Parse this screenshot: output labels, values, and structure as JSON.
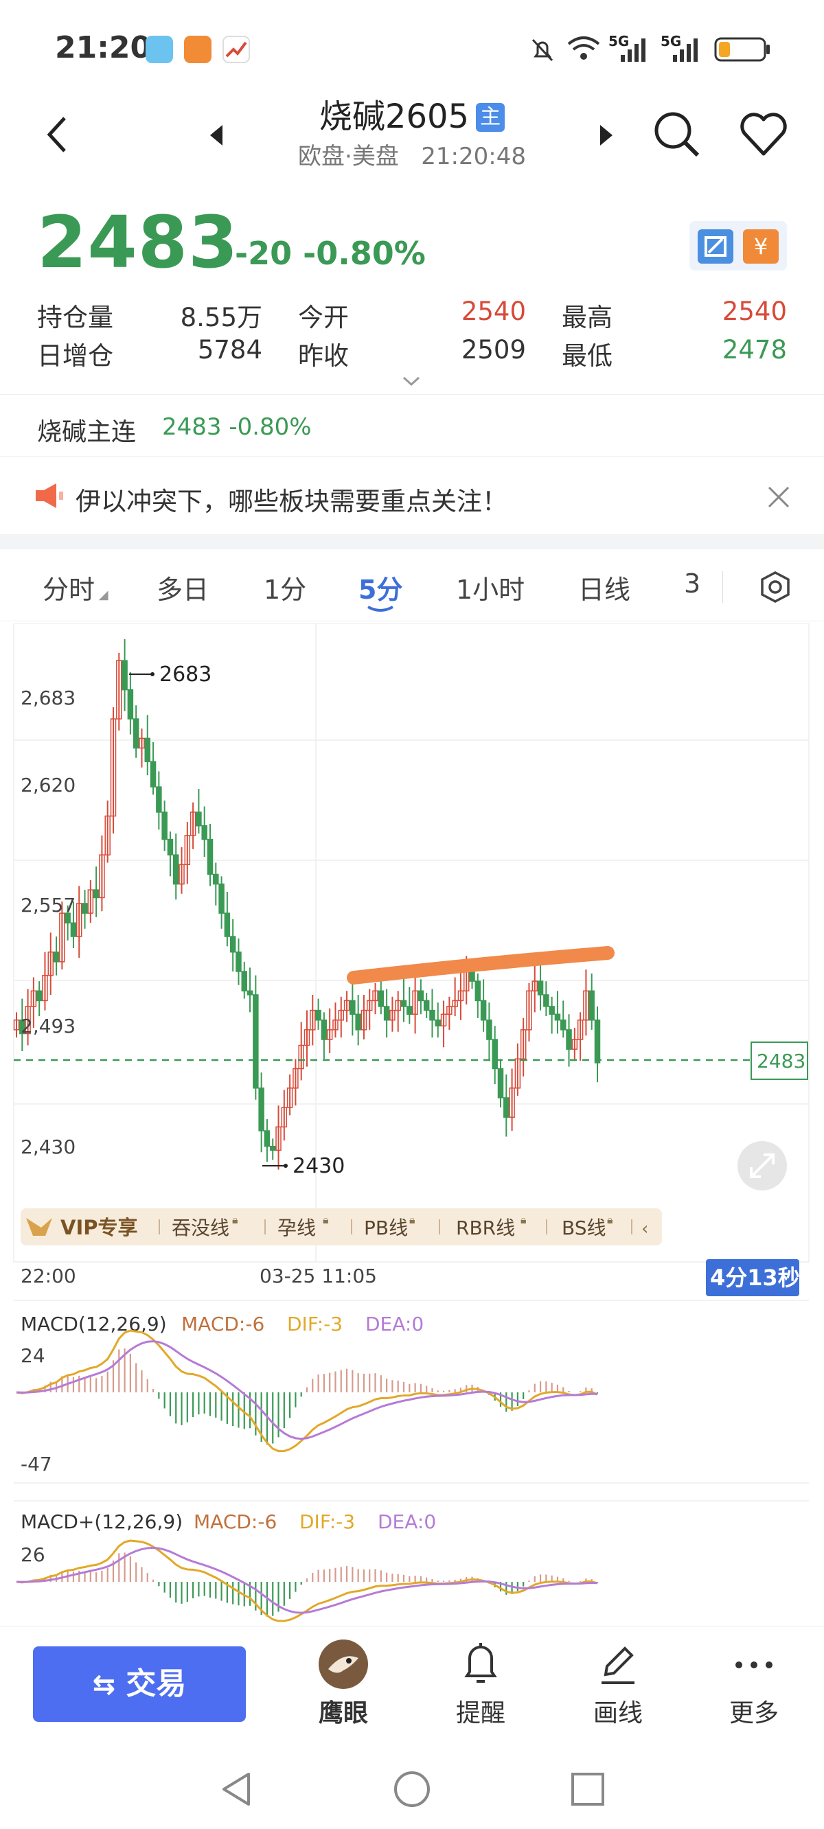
{
  "status": {
    "time": "21:20",
    "network1": "5G",
    "network2": "5G"
  },
  "header": {
    "title": "烧碱2605",
    "badge": "主",
    "market": "欧盘·美盘",
    "time": "21:20:48"
  },
  "quote": {
    "price": "2483",
    "change": "-20",
    "pct": "-0.80%",
    "stats": [
      {
        "label": "持仓量",
        "value": "8.55万",
        "label2": "今开",
        "value2": "2540",
        "label3": "最高",
        "value3": "2540"
      },
      {
        "label": "日增仓",
        "value": "5784",
        "label2": "昨收",
        "value2": "2509",
        "label3": "最低",
        "value3": "2478"
      }
    ]
  },
  "main_contract": {
    "name": "烧碱主连",
    "value": "2483 -0.80%"
  },
  "news": {
    "text": "伊以冲突下，哪些板块需要重点关注！"
  },
  "tabs": [
    "分时",
    "多日",
    "1分",
    "5分",
    "1小时",
    "日线",
    "3"
  ],
  "chart": {
    "y_ticks": [
      "2,683",
      "2,620",
      "2,557",
      "2,493",
      "2,430"
    ],
    "max_label": "2683",
    "min_label": "2430",
    "current": "2483",
    "x_labels": [
      "22:00",
      "03-25 11:05"
    ],
    "countdown": "4分13秒",
    "vip": {
      "title": "VIP专享",
      "items": [
        "吞没线",
        "孕线",
        "PB线",
        "RBR线",
        "BS线"
      ]
    },
    "macd1": {
      "title": "MACD(12,26,9)",
      "macd": "MACD:-6",
      "dif": "DIF:-3",
      "dea": "DEA:0",
      "top": "24",
      "bottom": "-47"
    },
    "macd2": {
      "title": "MACD+(12,26,9)",
      "macd": "MACD:-6",
      "dif": "DIF:-3",
      "dea": "DEA:0",
      "top": "26"
    }
  },
  "chart_data": {
    "type": "candlestick",
    "ylim": [
      2420,
      2700
    ],
    "closes": [
      2505,
      2498,
      2512,
      2520,
      2515,
      2528,
      2540,
      2535,
      2560,
      2555,
      2548,
      2565,
      2560,
      2572,
      2568,
      2590,
      2610,
      2660,
      2690,
      2675,
      2660,
      2645,
      2650,
      2638,
      2625,
      2612,
      2598,
      2590,
      2575,
      2585,
      2600,
      2612,
      2605,
      2598,
      2580,
      2575,
      2560,
      2548,
      2540,
      2530,
      2520,
      2518,
      2470,
      2448,
      2440,
      2438,
      2450,
      2460,
      2470,
      2480,
      2492,
      2500,
      2510,
      2505,
      2495,
      2500,
      2505,
      2510,
      2515,
      2508,
      2500,
      2510,
      2515,
      2520,
      2512,
      2505,
      2510,
      2515,
      2512,
      2508,
      2520,
      2515,
      2510,
      2505,
      2502,
      2508,
      2512,
      2515,
      2520,
      2530,
      2525,
      2515,
      2505,
      2495,
      2480,
      2465,
      2455,
      2470,
      2485,
      2500,
      2520,
      2525,
      2518,
      2512,
      2508,
      2505,
      2500,
      2490,
      2495,
      2505,
      2520,
      2505,
      2483
    ]
  },
  "nav": {
    "trade": "交易",
    "items": [
      "鹰眼",
      "提醒",
      "画线",
      "更多"
    ]
  }
}
